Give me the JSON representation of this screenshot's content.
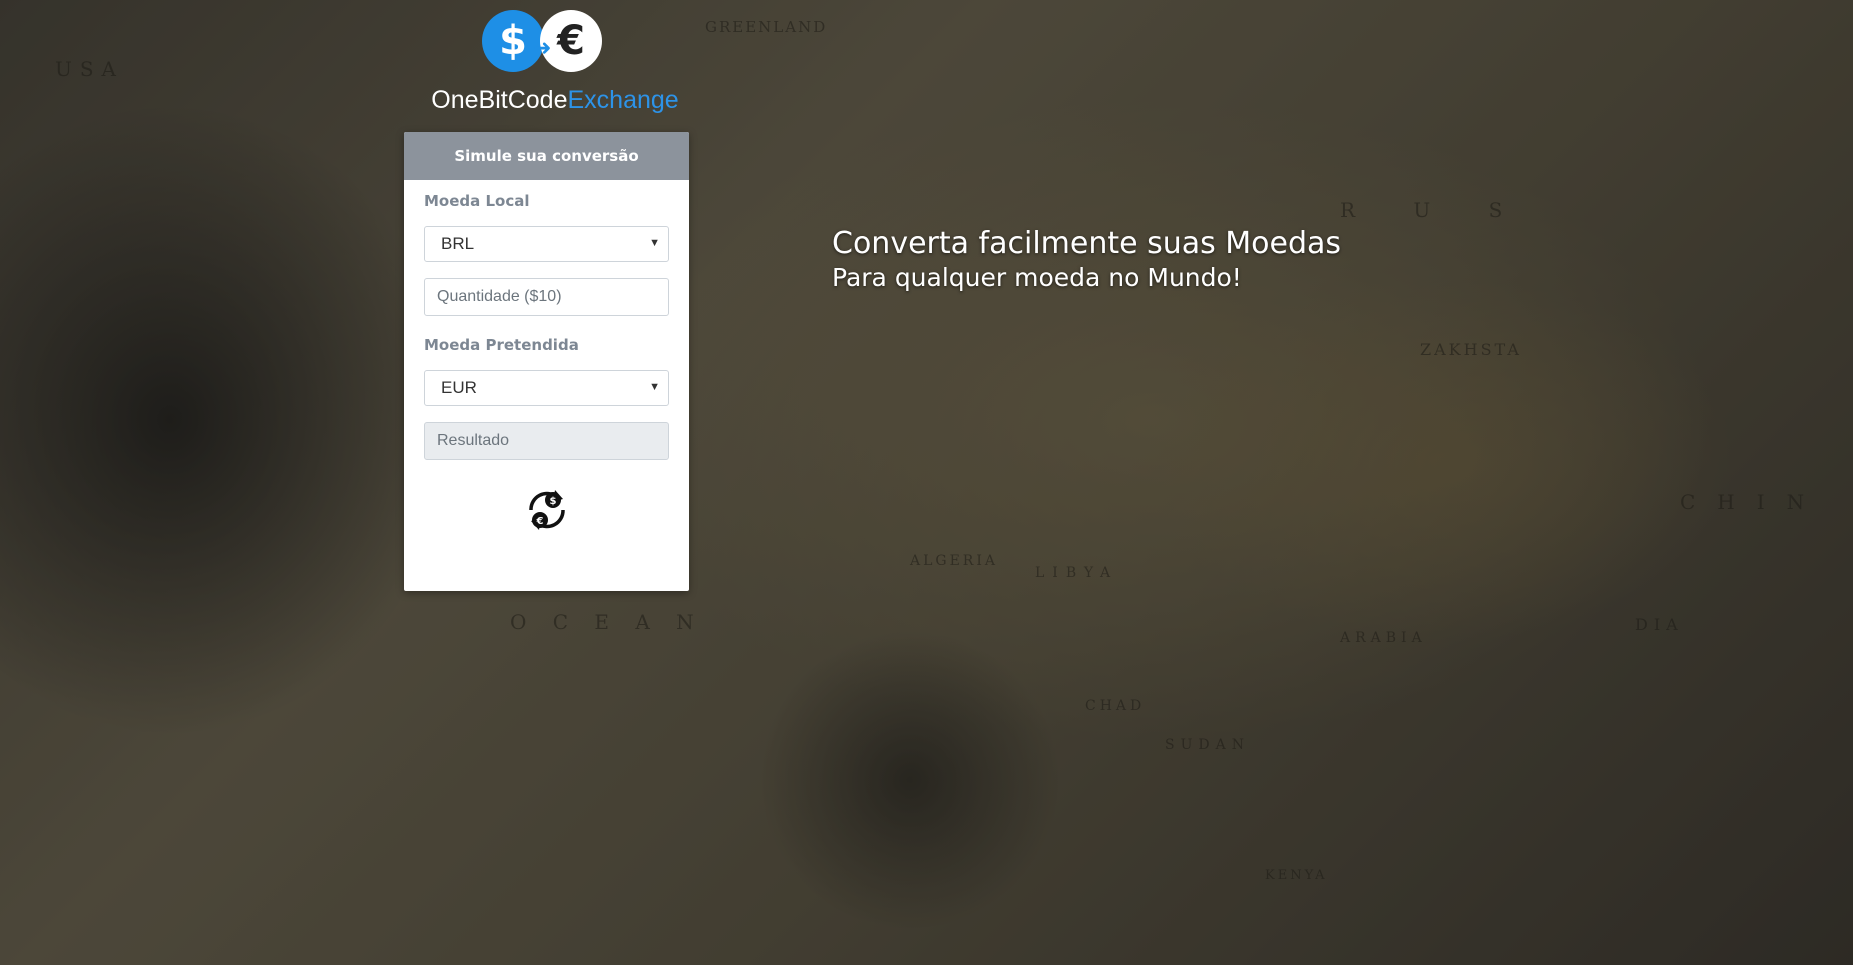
{
  "brand": {
    "name_part1": "OneBitCode",
    "name_part2": "Exchange",
    "dollar_symbol": "$",
    "euro_symbol": "€",
    "accent_color": "#2d93e8"
  },
  "form": {
    "header": "Simule sua conversão",
    "local_currency_label": "Moeda Local",
    "local_currency_value": "BRL",
    "quantity_placeholder": "Quantidade ($10)",
    "target_currency_label": "Moeda Pretendida",
    "target_currency_value": "EUR",
    "result_placeholder": "Resultado",
    "convert_icon": "currency-exchange-icon"
  },
  "headline": {
    "title": "Converta facilmente suas Moedas",
    "subtitle": "Para qualquer moeda no Mundo!"
  },
  "map_labels": [
    "USA",
    "GREENLAND",
    "R U S",
    "ZAKHSTA",
    "CHIN",
    "ALGERIA",
    "LIBYA",
    "SUDAN",
    "CHAD",
    "O C E A N",
    "KENYA",
    "ARABIA",
    "DIA"
  ]
}
